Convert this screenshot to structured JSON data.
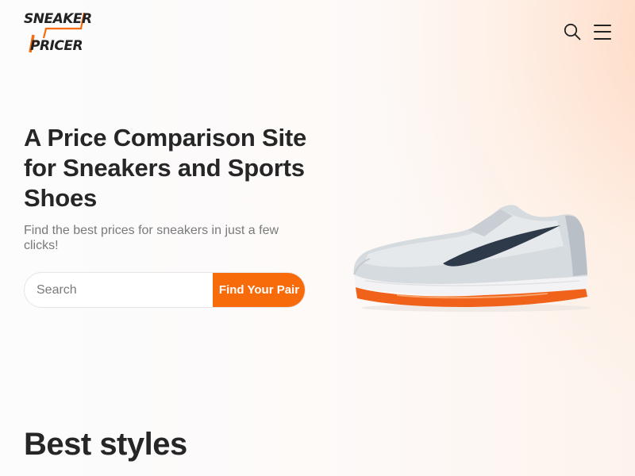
{
  "brand": {
    "line1": "SNEAKER",
    "line2": "PRICER",
    "accent_color": "#f86b0b"
  },
  "header": {
    "search_icon": "search-icon",
    "menu_icon": "hamburger-menu-icon"
  },
  "hero": {
    "title": "A Price Comparison Site for Sneakers and Sports Shoes",
    "subtitle": "Find the best prices for sneakers in just a few clicks!",
    "search_placeholder": "Search",
    "search_value": "",
    "cta_label": "Find Your Pair",
    "image": "sneaker-product-image"
  },
  "sections": {
    "best_styles_title": "Best styles"
  }
}
